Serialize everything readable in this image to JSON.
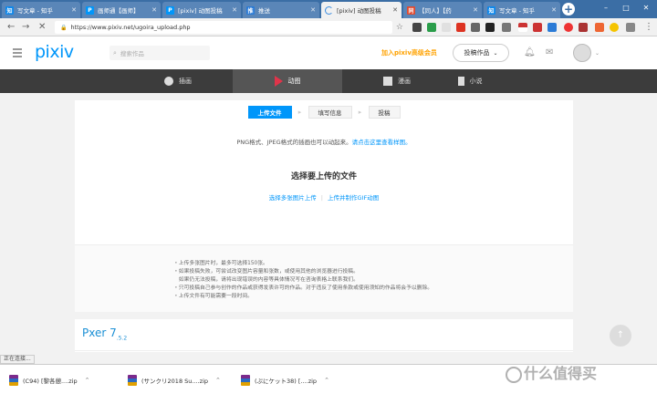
{
  "browser": {
    "tabs": [
      {
        "label": "写文章 - 知乎",
        "favicon": "知",
        "color": "#0f88eb",
        "active": false
      },
      {
        "label": "画师通【画师】",
        "favicon": "P",
        "color": "#0096fa",
        "active": false
      },
      {
        "label": "[pixiv] 动图投稿",
        "favicon": "P",
        "color": "#0096fa",
        "active": false
      },
      {
        "label": "推送",
        "favicon": "推",
        "color": "#2b7bd6",
        "active": false
      },
      {
        "label": "[pixiv] 动图投稿",
        "favicon": "",
        "color": "#cccccc",
        "active": true
      },
      {
        "label": "【同人】【药",
        "favicon": "同",
        "color": "#e04a2f",
        "active": false
      },
      {
        "label": "写文章 - 知乎",
        "favicon": "知",
        "color": "#0f88eb",
        "active": false
      }
    ],
    "url": "https://www.pixiv.net/ugoira_upload.php",
    "window_controls": [
      "–",
      "□",
      "✕"
    ]
  },
  "header": {
    "logo": "pixiv",
    "search_placeholder": "搜索作品",
    "premium_label": "加入pixiv高级会员",
    "post_button": "投稿作品"
  },
  "categories": [
    {
      "label": "插画",
      "icon": "apple-icon",
      "active": false
    },
    {
      "label": "动图",
      "icon": "play-icon",
      "active": true
    },
    {
      "label": "漫画",
      "icon": "manga-icon",
      "active": false
    },
    {
      "label": "小说",
      "icon": "novel-icon",
      "active": false
    }
  ],
  "upload": {
    "steps": [
      "上传文件",
      "填写信息",
      "投稿"
    ],
    "formats_text": "PNG格式、JPEG格式的插画也可以动起来。",
    "formats_link": "请点击这里查看样图。",
    "drop_heading": "选择要上传的文件",
    "link_multi": "选择多张图片上传",
    "link_gif": "上传并制作GIF动图",
    "notes": [
      "・上传多张图片时，最多可选择150张。",
      "・如果投稿失败，可尝试改变图片容量和张数，或使用其他的浏览器进行投稿。",
      "　如果仍无法投稿，请将出现错误的内容等具体情况写在咨询表格上联系我们。",
      "・只可投稿自己参与创作的作品或获得发表许可的作品。对于违反了使用条款或使用须知的作品将会予以删除。",
      "・上传文件有可能需要一段时间。"
    ]
  },
  "pxer": {
    "title": "Pxer 7",
    "version": ".5.2"
  },
  "status_text": "正在连接...",
  "downloads": [
    {
      "name": "(C94) [黎各憩....zip"
    },
    {
      "name": "(サンクリ2018 Su....zip"
    },
    {
      "name": "(ぷにケット38) [....zip"
    }
  ],
  "watermark": "什么值得买"
}
